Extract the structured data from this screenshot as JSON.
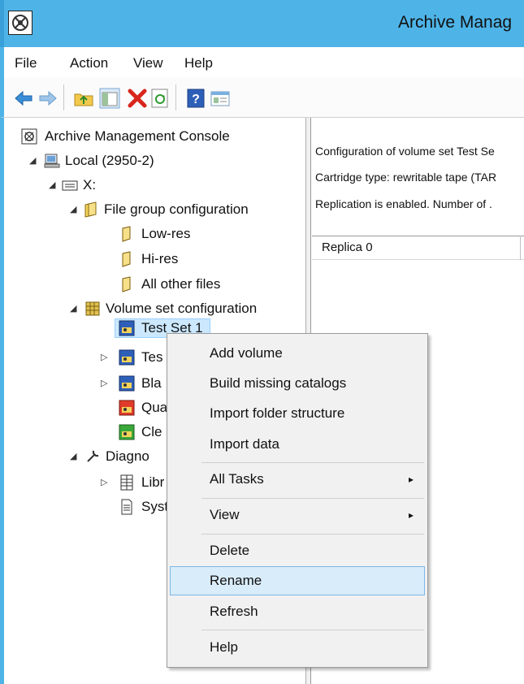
{
  "window": {
    "title": "Archive Manag"
  },
  "menu": [
    "File",
    "Action",
    "View",
    "Help"
  ],
  "toolbar": {
    "icons": [
      "back-icon",
      "forward-icon",
      "up-folder-icon",
      "show-hide-tree-icon",
      "delete-icon",
      "refresh-icon",
      "help-icon",
      "properties-icon"
    ]
  },
  "tree": {
    "root": "Archive Management Console",
    "local": "Local (2950-2)",
    "drive": "X:",
    "file_group": "File group configuration",
    "low_res": "Low-res",
    "hi_res": "Hi-res",
    "all_other": "All other files",
    "volume_set": "Volume set configuration",
    "test_set_1": "Test Set 1",
    "test_set_2": "Tes",
    "blank": "Bla",
    "quarantine": "Qua",
    "clean": "Cle",
    "diagnostics": "Diagno",
    "library": "Libr",
    "system": "Syst"
  },
  "info": {
    "line1": "Configuration of volume set Test Se",
    "line2": "Cartridge type: rewritable tape (TAR",
    "line3": "Replication is enabled.  Number of ."
  },
  "list": {
    "header": "Replica 0"
  },
  "context_menu": {
    "items": [
      "Add volume",
      "Build missing catalogs",
      "Import folder structure",
      "Import data",
      "All Tasks",
      "View",
      "Delete",
      "Rename",
      "Refresh",
      "Help"
    ],
    "arrow": "▸"
  },
  "colors": {
    "title_bar": "#4eb4e8",
    "selection": "#cce8ff",
    "menu_highlight": "#d9ecfa"
  }
}
